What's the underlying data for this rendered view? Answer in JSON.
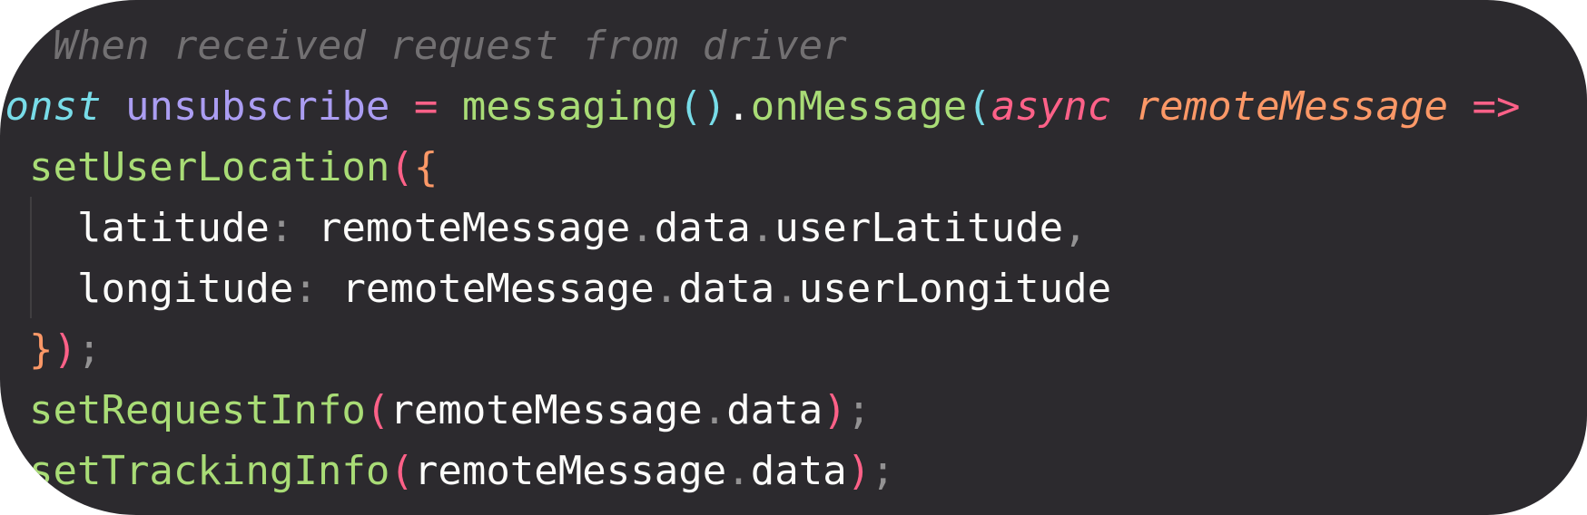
{
  "editor": {
    "theme_colors": {
      "background": "#2c2a2e",
      "comment": "#727072",
      "keyword": "#78dce8",
      "variable": "#ab9df2",
      "operator": "#ff6188",
      "function": "#a9dc76",
      "parameter": "#fc9867",
      "text": "#fcfcfa"
    },
    "lines": [
      {
        "comment": "// When received request from driver"
      },
      {
        "keyword": "const",
        "variable": "unsubscribe",
        "op": "=",
        "call": "messaging",
        "parens": "()",
        "dot": ".",
        "method": "onMessage",
        "open": "(",
        "async": "async",
        "param": "remoteMessage",
        "arrow": "=>"
      },
      {
        "indent": "  ",
        "call": "setUserLocation",
        "open": "(",
        "brace": "{"
      },
      {
        "indent": "    ",
        "key": "latitude",
        "colon": ":",
        "obj": "remoteMessage",
        "dot1": ".",
        "prop1": "data",
        "dot2": ".",
        "prop2": "userLatitude",
        "comma": ","
      },
      {
        "indent": "    ",
        "key": "longitude",
        "colon": ":",
        "obj": "remoteMessage",
        "dot1": ".",
        "prop1": "data",
        "dot2": ".",
        "prop2": "userLongitude"
      },
      {
        "indent": "  ",
        "brace": "}",
        "close": ")",
        "semi": ";"
      },
      {
        "indent": "  ",
        "call": "setRequestInfo",
        "open": "(",
        "obj": "remoteMessage",
        "dot": ".",
        "prop": "data",
        "close": ")",
        "semi": ";"
      },
      {
        "indent": "  ",
        "call": "setTrackingInfo",
        "open": "(",
        "obj": "remoteMessage",
        "dot": ".",
        "prop": "data",
        "close": ")",
        "semi": ";"
      }
    ]
  }
}
